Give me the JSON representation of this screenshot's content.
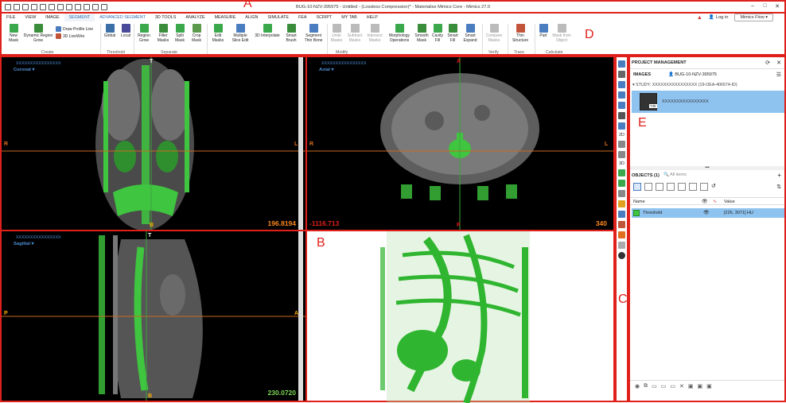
{
  "window": {
    "title": "BUG-10-NZV-395975 - Untitled - (Lossless Compression)* - Materialise Mimics Core - Mimics 27.0",
    "minimize": "–",
    "maximize": "□",
    "close": "✕"
  },
  "menu": {
    "items": [
      "FILE",
      "VIEW",
      "IMAGE",
      "SEGMENT",
      "ADVANCED SEGMENT",
      "3D TOOLS",
      "ANALYZE",
      "MEASURE",
      "ALIGN",
      "SIMULATE",
      "FEA",
      "SCRIPT",
      "MY TAB",
      "HELP"
    ],
    "active": "SEGMENT",
    "login": "Log in",
    "workflow": "Mimics Flow"
  },
  "ribbon": {
    "tools": [
      {
        "label": "New\nMask",
        "icon": "new-mask-icon"
      },
      {
        "label": "Dynamic Region\nGrow",
        "icon": "dynamic-region-grow-icon"
      },
      {
        "label": "Draw Profile Line",
        "icon": "profile-line-icon"
      },
      {
        "label": "3D LiveWire",
        "icon": "livewire-icon"
      },
      {
        "label": "Global",
        "icon": "global-threshold-icon"
      },
      {
        "label": "Local",
        "icon": "local-threshold-icon"
      },
      {
        "label": "Region\nGrow",
        "icon": "region-grow-icon"
      },
      {
        "label": "Filter\nMasks",
        "icon": "filter-masks-icon"
      },
      {
        "label": "Split\nMask",
        "icon": "split-mask-icon"
      },
      {
        "label": "Crop\nMask",
        "icon": "crop-mask-icon"
      },
      {
        "label": "Edit\nMasks",
        "icon": "edit-masks-icon"
      },
      {
        "label": "Multiple\nSlice Edit",
        "icon": "multiple-slice-edit-icon"
      },
      {
        "label": "3D Interpolate",
        "icon": "interpolate-icon"
      },
      {
        "label": "Smart\nBrush",
        "icon": "smart-brush-icon"
      },
      {
        "label": "Segment\nThin Bone",
        "icon": "thin-bone-icon"
      },
      {
        "label": "Unite\nMasks",
        "icon": "unite-masks-icon"
      },
      {
        "label": "Subtract\nMasks",
        "icon": "subtract-masks-icon"
      },
      {
        "label": "Intersect\nMasks",
        "icon": "intersect-masks-icon"
      },
      {
        "label": "Morphology\nOperations",
        "icon": "morphology-icon"
      },
      {
        "label": "Smooth\nMask",
        "icon": "smooth-mask-icon"
      },
      {
        "label": "Cavity\nFill",
        "icon": "cavity-fill-icon"
      },
      {
        "label": "Smart\nFill",
        "icon": "smart-fill-icon"
      },
      {
        "label": "Smart\nExpand",
        "icon": "smart-expand-icon"
      },
      {
        "label": "Compare\nMasks",
        "icon": "compare-masks-icon"
      },
      {
        "label": "Thin\nStructure",
        "icon": "thin-structure-icon"
      },
      {
        "label": "Part",
        "icon": "part-icon"
      },
      {
        "label": "Mask from\nObject",
        "icon": "mask-from-object-icon"
      }
    ],
    "groups": [
      "Create",
      "Threshold",
      "Separate",
      "Modify",
      "Verify",
      "Trace",
      "Calculate"
    ]
  },
  "viewports": {
    "coronal": {
      "name": "XXXXXXXXXXXXXXXX",
      "view": "Coronal",
      "top": "T",
      "bottom": "B",
      "left": "R",
      "right": "L",
      "value": "196.8194"
    },
    "axial": {
      "name": "XXXXXXXXXXXXXXXX",
      "view": "Axial",
      "top": "A",
      "bottom": "P",
      "left": "R",
      "right": "L",
      "value_left": "-1116.713",
      "value_right": "340"
    },
    "sagittal": {
      "name": "XXXXXXXXXXXXXXXX",
      "view": "Sagittal",
      "top": "T",
      "bottom": "B",
      "left": "P",
      "right": "A",
      "value": "230.0720"
    }
  },
  "toolstrip": {
    "labels": [
      "2D",
      "3D"
    ]
  },
  "project": {
    "title": "PROJECT MANAGEMENT",
    "images_label": "IMAGES",
    "image_id": "BUG-10-NZV-395975",
    "study": "STUDY: XXXXXXXXXXXXXXXX (19-OEA-406574-ID)",
    "series_name": "XXXXXXXXXXXXXXXX",
    "series_count": "735",
    "objects_label": "OBJECTS (1)",
    "search_placeholder": "All items",
    "columns": [
      "Name",
      "Value"
    ],
    "row": {
      "name": "Threshold",
      "value": "[226, 3071] HU"
    }
  },
  "annotations": [
    "A",
    "B",
    "C",
    "D",
    "E"
  ],
  "colors": {
    "accent": "#2a6cb0",
    "annotation": "#e0201a",
    "mask": "#3fc53f",
    "selection": "#8fc3ef"
  }
}
